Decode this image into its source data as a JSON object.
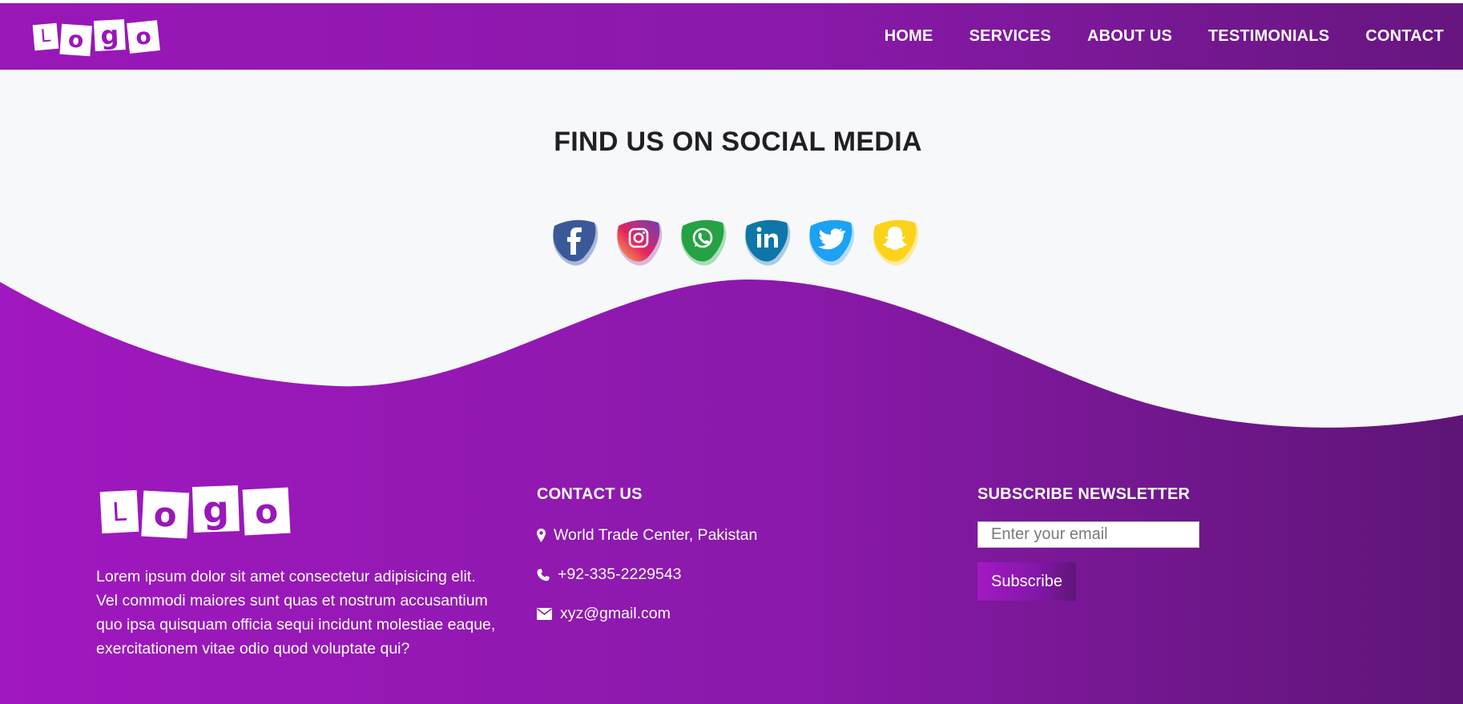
{
  "header": {
    "logo_letters": [
      "L",
      "o",
      "g",
      "o"
    ],
    "nav": [
      "HOME",
      "SERVICES",
      "ABOUT US",
      "TESTIMONIALS",
      "CONTACT"
    ]
  },
  "social": {
    "title": "FIND US ON SOCIAL MEDIA",
    "icons": [
      {
        "name": "facebook-icon",
        "color": "#3b5998"
      },
      {
        "name": "instagram-icon",
        "color": "#c13584"
      },
      {
        "name": "whatsapp-icon",
        "color": "#25a244"
      },
      {
        "name": "linkedin-icon",
        "color": "#0e76a8"
      },
      {
        "name": "twitter-icon",
        "color": "#1da1f2"
      },
      {
        "name": "snapchat-icon",
        "color": "#fcd21a"
      }
    ]
  },
  "footer": {
    "logo_letters": [
      "L",
      "o",
      "g",
      "o"
    ],
    "about_text": "Lorem ipsum dolor sit amet consectetur adipisicing elit. Vel commodi maiores sunt quas et nostrum accusantium quo ipsa quisquam officia sequi incidunt molestiae eaque, exercitationem vitae odio quod voluptate qui?",
    "contact": {
      "heading": "CONTACT US",
      "address": "World Trade Center, Pakistan",
      "phone": "+92-335-2229543",
      "email": "xyz@gmail.com"
    },
    "newsletter": {
      "heading": "SUBSCRIBE NEWSLETTER",
      "email_placeholder": "Enter your email",
      "email_value": "",
      "button_label": "Subscribe"
    }
  },
  "colors": {
    "brand_purple": "#9a17b8",
    "brand_purple_dark": "#5f1578",
    "background": "#f7f8fa"
  }
}
